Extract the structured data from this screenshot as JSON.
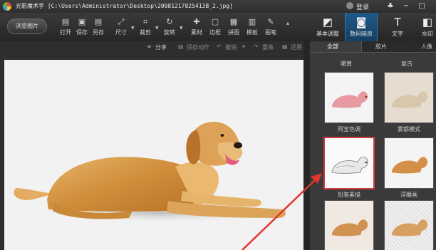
{
  "app": {
    "title": "光影魔术手 [C:\\Users\\Administrator\\Desktop\\20081217825413B_2.jpg]",
    "login_label": "登录",
    "accent": "#1e5a8a"
  },
  "toolbar": {
    "browse_label": "浏览图片",
    "tools": [
      {
        "label": "打开",
        "icon": "open-icon",
        "glyph": "▤"
      },
      {
        "label": "保存",
        "icon": "save-icon",
        "glyph": "▣"
      },
      {
        "label": "另存",
        "icon": "save-as-icon",
        "glyph": "▤"
      },
      {
        "label": "尺寸",
        "icon": "resize-icon",
        "glyph": "⤢"
      },
      {
        "label": "裁剪",
        "icon": "crop-icon",
        "glyph": "⌗"
      },
      {
        "label": "旋转",
        "icon": "rotate-icon",
        "glyph": "↻"
      },
      {
        "label": "素材",
        "icon": "material-icon",
        "glyph": "✚"
      },
      {
        "label": "边框",
        "icon": "border-icon",
        "glyph": "▢"
      },
      {
        "label": "拼图",
        "icon": "collage-icon",
        "glyph": "▦"
      },
      {
        "label": "模板",
        "icon": "template-icon",
        "glyph": "▥"
      },
      {
        "label": "画笔",
        "icon": "brush-icon",
        "glyph": "✎"
      }
    ],
    "more_glyph": "▴",
    "tabs": [
      {
        "label": "基本调整",
        "icon": "basic-adjust-icon",
        "glyph": "◩"
      },
      {
        "label": "数码暗房",
        "icon": "darkroom-icon",
        "glyph": "◙"
      },
      {
        "label": "文字",
        "icon": "text-icon",
        "glyph": "T"
      },
      {
        "label": "水印",
        "icon": "watermark-icon",
        "glyph": "◧"
      }
    ]
  },
  "subbar": {
    "share": "分享",
    "save_action": "保存动作",
    "undo": "撤销",
    "redo": "重做",
    "reset": "还原"
  },
  "panel": {
    "tabs": [
      "全部",
      "胶片",
      "人像"
    ],
    "top_labels": [
      "暖黄",
      "复古"
    ],
    "effects": [
      {
        "name": "阿宝色调",
        "style": "pink"
      },
      {
        "name": "雾都模式",
        "style": "fog"
      },
      {
        "name": "铅笔素描",
        "style": "pencil",
        "selected": true
      },
      {
        "name": "浮雕画",
        "style": "emboss"
      },
      {
        "name": "",
        "style": "normal"
      },
      {
        "name": "",
        "style": "texture"
      }
    ]
  }
}
